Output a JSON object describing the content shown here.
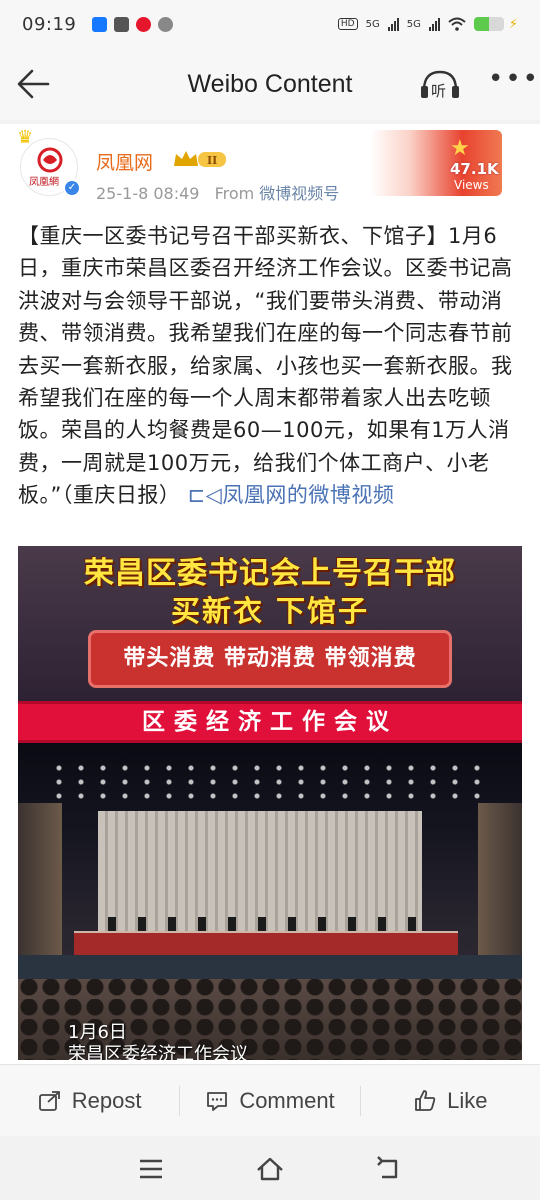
{
  "status": {
    "time": "09:19",
    "left_icons": [
      "alipay-icon",
      "message-icon",
      "weibo-icon",
      "wechat-icon"
    ],
    "hd_label": "HD",
    "net1": "5G",
    "net2": "5G",
    "battery_level": 0.5
  },
  "header": {
    "title": "Weibo Content",
    "listen_label": "听"
  },
  "post": {
    "username": "凤凰网",
    "avatar_text": "凤凰網",
    "level": "II",
    "date": "25-1-8 08:49",
    "from_label": "From",
    "source": "微博视频号",
    "views": "47.1K",
    "views_label": "Views",
    "text": "【重庆一区委书记号召干部买新衣、下馆子】1月6日，重庆市荣昌区委召开经济工作会议。区委书记高洪波对与会领导干部说，“我们要带头消费、带动消费、带领消费。我希望我们在座的每一个同志春节前去买一套新衣服，给家属、小孩也买一套新衣服。我希望我们在座的每一个人周末都带着家人出去吃顿饭。荣昌的人均餐费是60—100元，如果有1万人消费，一周就是100万元，给我们个体工商户、小老板。”（重庆日报）",
    "video_link": "凤凰网的微博视频"
  },
  "video": {
    "title_line1": "荣昌区委书记会上号召干部",
    "title_line2": "买新衣 下馆子",
    "pill": "带头消费 带动消费 带领消费",
    "banner": "区委经济工作会议",
    "caption_date": "1月6日",
    "caption_event": "荣昌区委经济工作会议"
  },
  "actions": {
    "repost": "Repost",
    "comment": "Comment",
    "like": "Like"
  },
  "colors": {
    "username": "#e86a1a",
    "link": "#4a72b5",
    "banner_red": "#e0103a",
    "title_yellow": "#ffe640"
  }
}
